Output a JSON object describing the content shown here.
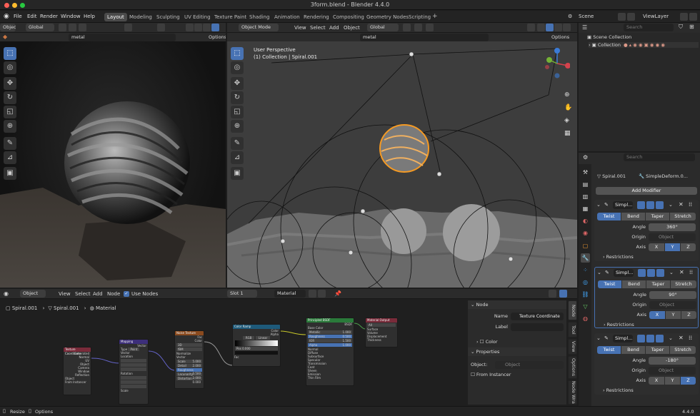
{
  "window": {
    "title": "3form.blend - Blender 4.4.0"
  },
  "menu": {
    "items": [
      "File",
      "Edit",
      "Render",
      "Window",
      "Help"
    ]
  },
  "workspaces": [
    {
      "label": "Layout",
      "active": true
    },
    {
      "label": "Modeling"
    },
    {
      "label": "Sculpting"
    },
    {
      "label": "UV Editing"
    },
    {
      "label": "Texture Paint"
    },
    {
      "label": "Shading"
    },
    {
      "label": "Animation"
    },
    {
      "label": "Rendering"
    },
    {
      "label": "Compositing"
    },
    {
      "label": "Geometry Nodes"
    },
    {
      "label": "Scripting"
    }
  ],
  "scene": {
    "label": "Scene",
    "viewlayer": "ViewLayer"
  },
  "left_view": {
    "mode": "Object",
    "orientation": "Global",
    "search": "metal",
    "options": "Options"
  },
  "main_view": {
    "mode": "Object Mode",
    "menus": [
      "View",
      "Select",
      "Add",
      "Object"
    ],
    "orientation": "Global",
    "search": "metal",
    "options": "Options",
    "overlay_line1": "User Perspective",
    "overlay_line2": "(1) Collection | Spiral.001"
  },
  "outliner": {
    "search_placeholder": "Search",
    "scene_collection": "Scene Collection",
    "collection": "Collection"
  },
  "properties": {
    "search_placeholder": "Search",
    "object": "Spiral.001",
    "modifier_name": "SimpleDeform.0...",
    "add_modifier": "Add Modifier",
    "modifiers": [
      {
        "name": "Simpl...",
        "modes": [
          "Twist",
          "Bend",
          "Taper",
          "Stretch"
        ],
        "angle_label": "Angle",
        "angle": "360°",
        "origin_label": "Origin",
        "origin_placeholder": "Object",
        "axis_label": "Axis",
        "axis": [
          "X",
          "Y",
          "Z"
        ],
        "active_axis": 1,
        "restrictions": "Restrictions"
      },
      {
        "name": "Simpl...",
        "modes": [
          "Twist",
          "Bend",
          "Taper",
          "Stretch"
        ],
        "angle_label": "Angle",
        "angle": "90°",
        "origin_label": "Origin",
        "origin_placeholder": "Object",
        "axis_label": "Axis",
        "axis": [
          "X",
          "Y",
          "Z"
        ],
        "active_axis": 0,
        "restrictions": "Restrictions"
      },
      {
        "name": "Simpl...",
        "modes": [
          "Twist",
          "Bend",
          "Taper",
          "Stretch"
        ],
        "angle_label": "Angle",
        "angle": "-180°",
        "origin_label": "Origin",
        "origin_placeholder": "Object",
        "axis_label": "Axis",
        "axis": [
          "X",
          "Y",
          "Z"
        ],
        "active_axis": 2,
        "restrictions": "Restrictions"
      }
    ]
  },
  "node_editor": {
    "mode": "Object",
    "menus": [
      "View",
      "Select",
      "Add",
      "Node"
    ],
    "use_nodes": "Use Nodes",
    "slot": "Slot 1",
    "material": "Material",
    "breadcrumb": [
      "Spiral.001",
      "Spiral.001",
      "Material"
    ],
    "sidebar": {
      "node_title": "Node",
      "name_label": "Name",
      "name_value": "Texture Coordinate",
      "label_label": "Label",
      "color_label": "Color",
      "properties_title": "Properties",
      "object_label": "Object:",
      "object_placeholder": "Object",
      "from_instancer": "From Instancer"
    },
    "vtabs": [
      "Node",
      "Tool",
      "View",
      "Options",
      "Node Wra"
    ],
    "nodes": {
      "texcoord": {
        "title": "Texture Coordinate",
        "rows": [
          "Generated",
          "Normal",
          "UV",
          "Object",
          "Camera",
          "Window",
          "Reflection",
          "Object",
          "From Instancer"
        ]
      },
      "mapping": {
        "title": "Mapping",
        "rows": [
          "Vector",
          "Type",
          "Point",
          "Vector",
          "Location",
          "Rotation",
          "Scale"
        ]
      },
      "noise": {
        "title": "Noise Texture",
        "rows": [
          "Fac",
          "Color",
          "3D",
          "fBM",
          "Normalize",
          "Vector",
          "Scale",
          "5.000",
          "Detail",
          "2.000",
          "Roughness",
          "0.500",
          "Lacunarity",
          "2.000",
          "Distortion",
          "0.000"
        ]
      },
      "ramp": {
        "title": "Color Ramp",
        "rows": [
          "Color",
          "Alpha",
          "RGB",
          "Linear",
          "Pos",
          "0.000",
          "Fac"
        ]
      },
      "bsdf": {
        "title": "Principled BSDF",
        "rows": [
          "BSDF",
          "Base Color",
          "Metallic",
          "1.000",
          "Roughness",
          "0.500",
          "IOR",
          "1.500",
          "Alpha",
          "1.000",
          "Normal",
          "Diffuse",
          "Subsurface",
          "Specular",
          "Transmission",
          "Coat",
          "Sheen",
          "Emission",
          "Thin Film"
        ]
      },
      "output": {
        "title": "Material Output",
        "rows": [
          "All",
          "Surface",
          "Volume",
          "Displacement",
          "Thickness"
        ]
      }
    }
  },
  "status": {
    "resize": "Resize",
    "options": "Options",
    "version": "4.4.0"
  }
}
